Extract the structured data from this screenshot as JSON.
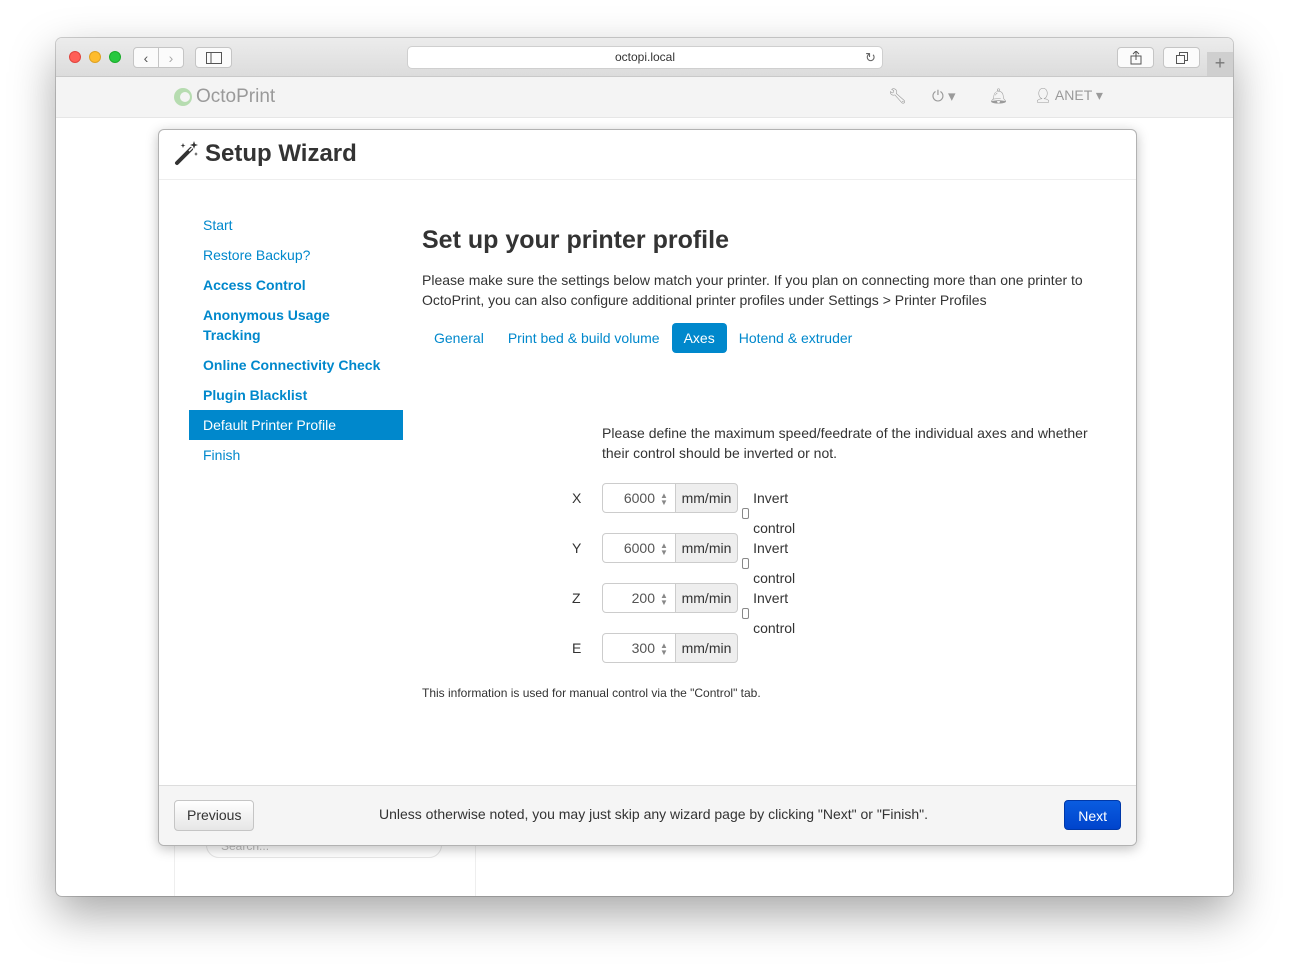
{
  "browser": {
    "url": "octopi.local",
    "colors": {
      "close": "#ff5f57",
      "minimize": "#febc2e",
      "zoom": "#28c840"
    }
  },
  "navbar": {
    "brand": "OctoPrint",
    "user": "ANET"
  },
  "background": {
    "search_placeholder": "Search..."
  },
  "wizard": {
    "title": "Setup Wizard",
    "sidebar": [
      {
        "label": "Start"
      },
      {
        "label": "Restore Backup?"
      },
      {
        "label": "Access Control"
      },
      {
        "label": "Anonymous Usage Tracking"
      },
      {
        "label": "Online Connectivity Check"
      },
      {
        "label": "Plugin Blacklist"
      },
      {
        "label": "Default Printer Profile"
      },
      {
        "label": "Finish"
      }
    ],
    "heading": "Set up your printer profile",
    "intro": "Please make sure the settings below match your printer. If you plan on connecting more than one printer to OctoPrint, you can also configure additional printer profiles under Settings > Printer Profiles",
    "tabs": [
      {
        "label": "General"
      },
      {
        "label": "Print bed & build volume"
      },
      {
        "label": "Axes"
      },
      {
        "label": "Hotend & extruder"
      }
    ],
    "axes_description": "Please define the maximum speed/feedrate of the individual axes and whether their control should be inverted or not.",
    "axes": [
      {
        "name": "X",
        "value": "6000",
        "unit": "mm/min",
        "invert_label": "Invert control"
      },
      {
        "name": "Y",
        "value": "6000",
        "unit": "mm/min",
        "invert_label": "Invert control"
      },
      {
        "name": "Z",
        "value": "200",
        "unit": "mm/min",
        "invert_label": "Invert control"
      },
      {
        "name": "E",
        "value": "300",
        "unit": "mm/min"
      }
    ],
    "note": "This information is used for manual control via the \"Control\" tab.",
    "footer": {
      "previous": "Previous",
      "text": "Unless otherwise noted, you may just skip any wizard page by clicking \"Next\" or \"Finish\".",
      "next": "Next"
    }
  }
}
